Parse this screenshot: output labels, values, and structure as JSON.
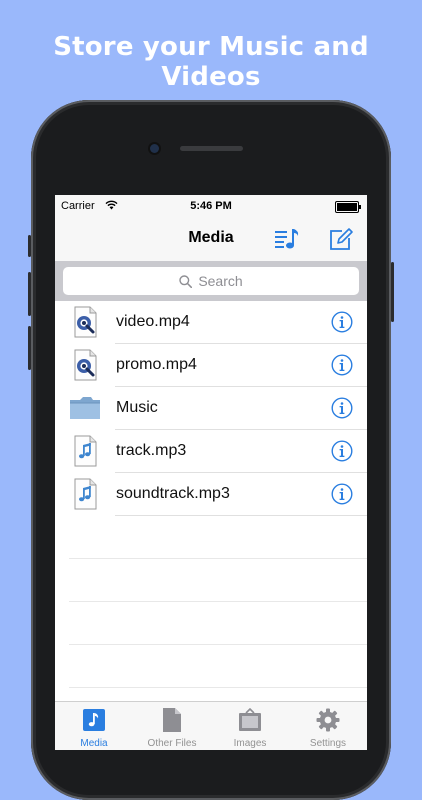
{
  "headline": "Store your Music and Videos",
  "status": {
    "carrier": "Carrier",
    "time": "5:46 PM"
  },
  "nav": {
    "title": "Media"
  },
  "search": {
    "placeholder": "Search"
  },
  "files": [
    {
      "name": "video.mp4",
      "icon": "video-file-icon"
    },
    {
      "name": "promo.mp4",
      "icon": "video-file-icon"
    },
    {
      "name": "Music",
      "icon": "folder-icon"
    },
    {
      "name": "track.mp3",
      "icon": "audio-file-icon"
    },
    {
      "name": "soundtrack.mp3",
      "icon": "audio-file-icon"
    }
  ],
  "tabs": [
    {
      "label": "Media",
      "icon": "media-icon",
      "active": true
    },
    {
      "label": "Other Files",
      "icon": "document-icon",
      "active": false
    },
    {
      "label": "Images",
      "icon": "image-frame-icon",
      "active": false
    },
    {
      "label": "Settings",
      "icon": "gear-icon",
      "active": false
    }
  ],
  "colors": {
    "background": "#9ab8fb",
    "accent": "#2a7ee0",
    "tab_inactive": "#929292"
  }
}
